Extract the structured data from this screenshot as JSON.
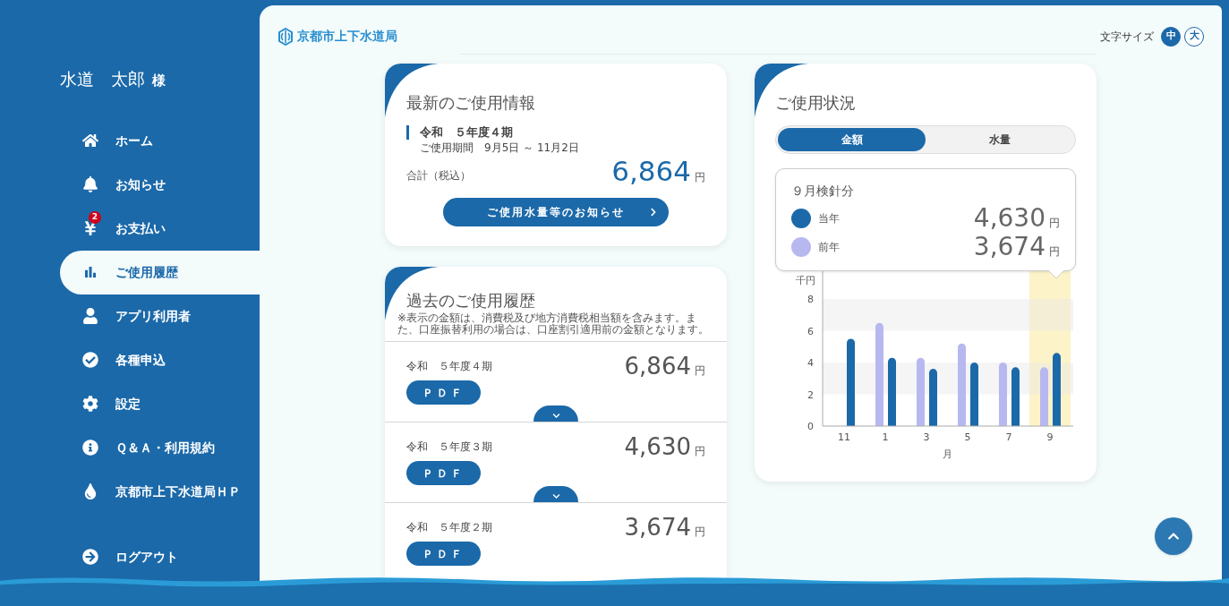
{
  "user": {
    "name": "水道　太郎",
    "honorific": "様"
  },
  "nav": [
    {
      "kind": "home",
      "label": "ホーム",
      "selected": false
    },
    {
      "kind": "bell",
      "label": "お知らせ",
      "selected": false
    },
    {
      "kind": "yen",
      "label": "お支払い",
      "selected": false,
      "badge": "2"
    },
    {
      "kind": "chart",
      "label": "ご使用履歴",
      "selected": true
    },
    {
      "kind": "user",
      "label": "アプリ利用者",
      "selected": false
    },
    {
      "kind": "check",
      "label": "各種申込",
      "selected": false
    },
    {
      "kind": "gear",
      "label": "設定",
      "selected": false
    },
    {
      "kind": "info",
      "label": "Ｑ＆Ａ・利用規約",
      "selected": false
    },
    {
      "kind": "drop",
      "label": "京都市上下水道局ＨＰ",
      "selected": false
    }
  ],
  "logout": "ログアウト",
  "header": {
    "logo": "京都市上下水道局",
    "font_size_label": "文字サイズ",
    "font_sizes": [
      {
        "label": "中",
        "selected": true
      },
      {
        "label": "大",
        "selected": false
      }
    ]
  },
  "latest": {
    "title": "最新のご使用情報",
    "period": "令和　５年度４期",
    "usage_period": "ご使用期間　9月5日 ～ 11月2日",
    "total_label": "合計（税込）",
    "amount": "6,864",
    "unit": "円",
    "button": "ご使用水量等のお知らせ"
  },
  "history": {
    "title": "過去のご使用履歴",
    "note": "※表示の金額は、消費税及び地方消費税相当額を含みます。また、口座振替利用の場合は、口座割引適用前の金額となります。",
    "rows": [
      {
        "period": "令和　５年度４期",
        "amount": "6,864",
        "unit": "円",
        "button": "ＰＤＦ",
        "expanded": false
      },
      {
        "period": "令和　５年度３期",
        "amount": "4,630",
        "unit": "円",
        "button": "ＰＤＦ",
        "expanded": false
      },
      {
        "period": "令和　５年度２期",
        "amount": "3,674",
        "unit": "円",
        "button": "ＰＤＦ"
      }
    ]
  },
  "usage": {
    "title": "ご使用状況",
    "tabs": [
      {
        "label": "金額",
        "selected": true
      },
      {
        "label": "水量",
        "selected": false
      }
    ],
    "tooltip": {
      "title": "９月検針分",
      "items": [
        {
          "amount": "4,630",
          "unit": "円"
        },
        {
          "amount": "3,674",
          "unit": "円"
        }
      ]
    },
    "chart_data": {
      "type": "bar",
      "xlabel": "月",
      "ylabel": "千円",
      "categories": [
        "11",
        "1",
        "3",
        "5",
        "7",
        "9"
      ],
      "series": [
        {
          "name": "当年",
          "color": "#1b69a9",
          "values": [
            5.5,
            4.3,
            3.6,
            4.0,
            3.7,
            4.6
          ]
        },
        {
          "name": "前年",
          "color": "#b8b8f0",
          "values": [
            null,
            6.5,
            4.3,
            5.2,
            4.0,
            3.7
          ]
        }
      ],
      "ylim": [
        0,
        8
      ],
      "yticks": [
        0,
        2,
        4,
        6,
        8
      ]
    }
  }
}
